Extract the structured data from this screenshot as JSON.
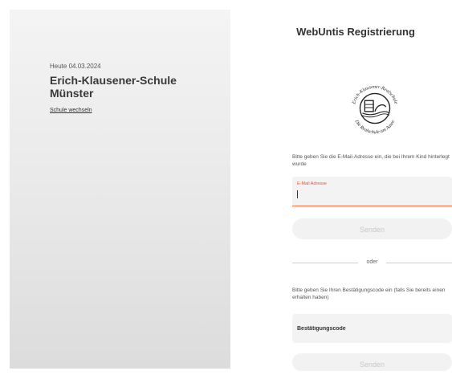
{
  "left": {
    "date": "Heute 04.03.2024",
    "school_name": "Erich-Klausener-Schule Münster",
    "change_school": "Schule wechseln"
  },
  "right": {
    "title": "WebUntis Registrierung",
    "logo_text_top": "Erich-Klausener-Realschule",
    "logo_text_bottom": "Die Realschule am Aasee",
    "instruction_email": "Bitte geben Sie die E-Mail-Adresse ein, die bei Ihrem Kind hinterlegt wurde",
    "email": {
      "label": "E-Mail Adresse",
      "value": ""
    },
    "send_label": "Senden",
    "or_label": "oder",
    "instruction_code": "Bitte geben Sie Ihren Bestätigungscode ein (falls Sie bereits einen erhalten haben)",
    "code": {
      "placeholder": "Bestätigungscode",
      "value": ""
    },
    "send2_label": "Senden"
  },
  "colors": {
    "accent": "#ff7043",
    "label_accent": "#e0553b",
    "button_bg": "#f2f2f2",
    "field_bg": "#f3f3f3"
  }
}
